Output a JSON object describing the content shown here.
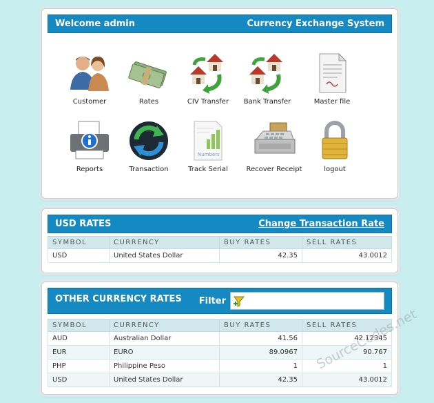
{
  "header": {
    "welcome": "Welcome admin",
    "system_title": "Currency Exchange System"
  },
  "menu": {
    "items": [
      {
        "label": "Customer",
        "icon": "customer-icon"
      },
      {
        "label": "Rates",
        "icon": "money-icon"
      },
      {
        "label": "CIV Transfer",
        "icon": "house-transfer-icon"
      },
      {
        "label": "Bank Transfer",
        "icon": "house-transfer-icon"
      },
      {
        "label": "Master file",
        "icon": "document-icon"
      },
      {
        "label": "Reports",
        "icon": "printer-info-icon"
      },
      {
        "label": "Transaction",
        "icon": "sync-icon"
      },
      {
        "label": "Track Serial",
        "icon": "numbers-sheet-icon"
      },
      {
        "label": "Recover Receipt",
        "icon": "cash-register-icon"
      },
      {
        "label": "logout",
        "icon": "padlock-icon"
      }
    ]
  },
  "usd_panel": {
    "title": "USD RATES",
    "change_link": "Change Transaction Rate",
    "columns": [
      "SYMBOL",
      "CURRENCY",
      "BUY RATES",
      "SELL RATES"
    ],
    "rows": [
      [
        "USD",
        "United States Dollar",
        "42.35",
        "43.0012"
      ]
    ]
  },
  "other_panel": {
    "title": "OTHER CURRENCY RATES",
    "filter_label": "Filter",
    "filter_value": "",
    "columns": [
      "SYMBOL",
      "CURRENCY",
      "BUY RATES",
      "SELL RATES"
    ],
    "rows": [
      [
        "AUD",
        "Australian Dollar",
        "41.56",
        "42.12345"
      ],
      [
        "EUR",
        "EURO",
        "89.0967",
        "90.767"
      ],
      [
        "PHP",
        "Philippine Peso",
        "1",
        "1"
      ],
      [
        "USD",
        "United States Dollar",
        "42.35",
        "43.0012"
      ]
    ]
  },
  "watermark": "SourceCodes.net",
  "colors": {
    "background": "#c9eef0",
    "header_bar": "#1489c2",
    "table_header": "#d1e9ec"
  }
}
